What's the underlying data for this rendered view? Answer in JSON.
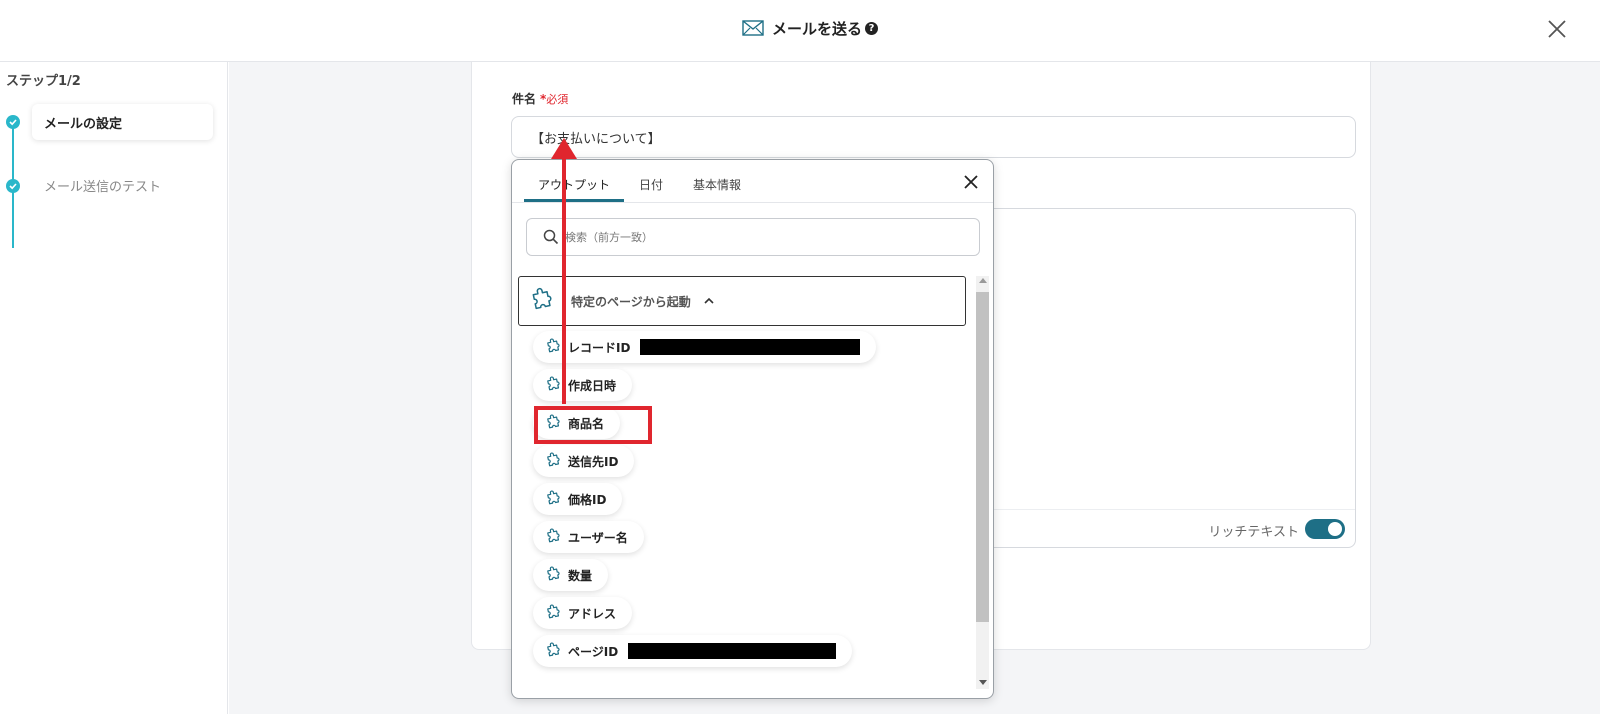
{
  "header": {
    "title": "メールを送る",
    "help_glyph": "?",
    "close_glyph": "×"
  },
  "sidebar": {
    "step_count": "ステップ1/2",
    "steps": [
      {
        "label": "メールの設定",
        "state": "active"
      },
      {
        "label": "メール送信のテスト",
        "state": "done"
      }
    ]
  },
  "form": {
    "subject_label": "件名",
    "required_star": "*",
    "required_text": "必須",
    "subject_value": "【お支払いについて】",
    "rich_text_label": "リッチテキスト",
    "rich_text_enabled": true
  },
  "popup": {
    "tabs": [
      {
        "label": "アウトプット",
        "active": true
      },
      {
        "label": "日付",
        "active": false
      },
      {
        "label": "基本情報",
        "active": false
      }
    ],
    "search_placeholder": "検索（前方一致）",
    "group_label": "特定のページから起動",
    "items": [
      {
        "label": "レコードID",
        "redacted": true
      },
      {
        "label": "作成日時",
        "redacted": false
      },
      {
        "label": "商品名",
        "redacted": false,
        "highlighted": true
      },
      {
        "label": "送信先ID",
        "redacted": false
      },
      {
        "label": "価格ID",
        "redacted": false
      },
      {
        "label": "ユーザー名",
        "redacted": false
      },
      {
        "label": "数量",
        "redacted": false
      },
      {
        "label": "アドレス",
        "redacted": false
      },
      {
        "label": "ページID",
        "redacted": true
      }
    ]
  },
  "colors": {
    "accent": "#1e6f86",
    "step": "#2ab7ca",
    "required": "#e0262e",
    "annotation": "#e0262e"
  }
}
